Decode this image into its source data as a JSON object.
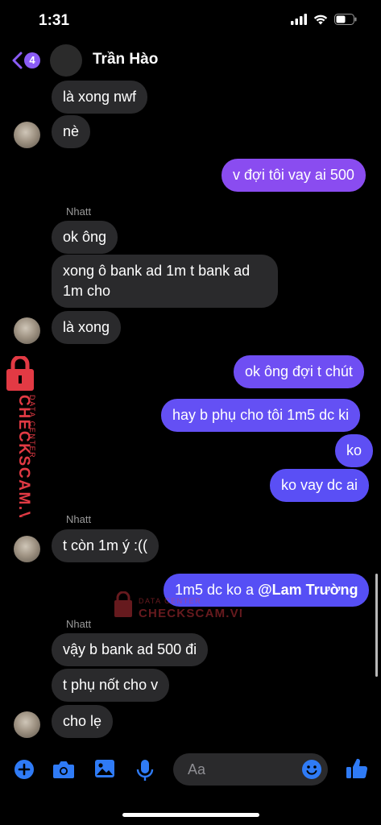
{
  "status_bar": {
    "time": "1:31"
  },
  "header": {
    "back_badge": "4",
    "contact_name": "Trần Hào"
  },
  "messages": [
    {
      "text": "là xong nwf"
    },
    {
      "text": "nè"
    },
    {
      "text": "v đợi tôi vay ai 500"
    },
    {
      "sender": "Nhatt"
    },
    {
      "text": "ok ông"
    },
    {
      "text_line1": "xong ô bank ad 1m t bank ad",
      "text_line2": "1m cho"
    },
    {
      "text": "là xong"
    },
    {
      "text": "ok ông đợi t chút"
    },
    {
      "text": "hay b phụ cho tôi 1m5 dc ki"
    },
    {
      "text": "ko"
    },
    {
      "text": "ko vay dc ai"
    },
    {
      "sender": "Nhatt"
    },
    {
      "text": "t còn 1m ý :(("
    },
    {
      "text": "1m5 dc ko a ",
      "mention": "@Lam Trường"
    },
    {
      "sender": "Nhatt"
    },
    {
      "text": "vậy b bank ad 500 đi"
    },
    {
      "text": "t phụ nốt cho v"
    },
    {
      "text": "cho lẹ"
    }
  ],
  "composer": {
    "placeholder": "Aa"
  },
  "watermark": {
    "brand": "CHECKSCAM.VN",
    "tagline": "DATA CENTER"
  },
  "colors": {
    "outgoing_top": "#8a4cf0",
    "outgoing_bottom": "#5b4ff5",
    "incoming": "#2a2a2c",
    "icon_blue": "#2f7bf6",
    "watermark_red": "#e23a44"
  }
}
